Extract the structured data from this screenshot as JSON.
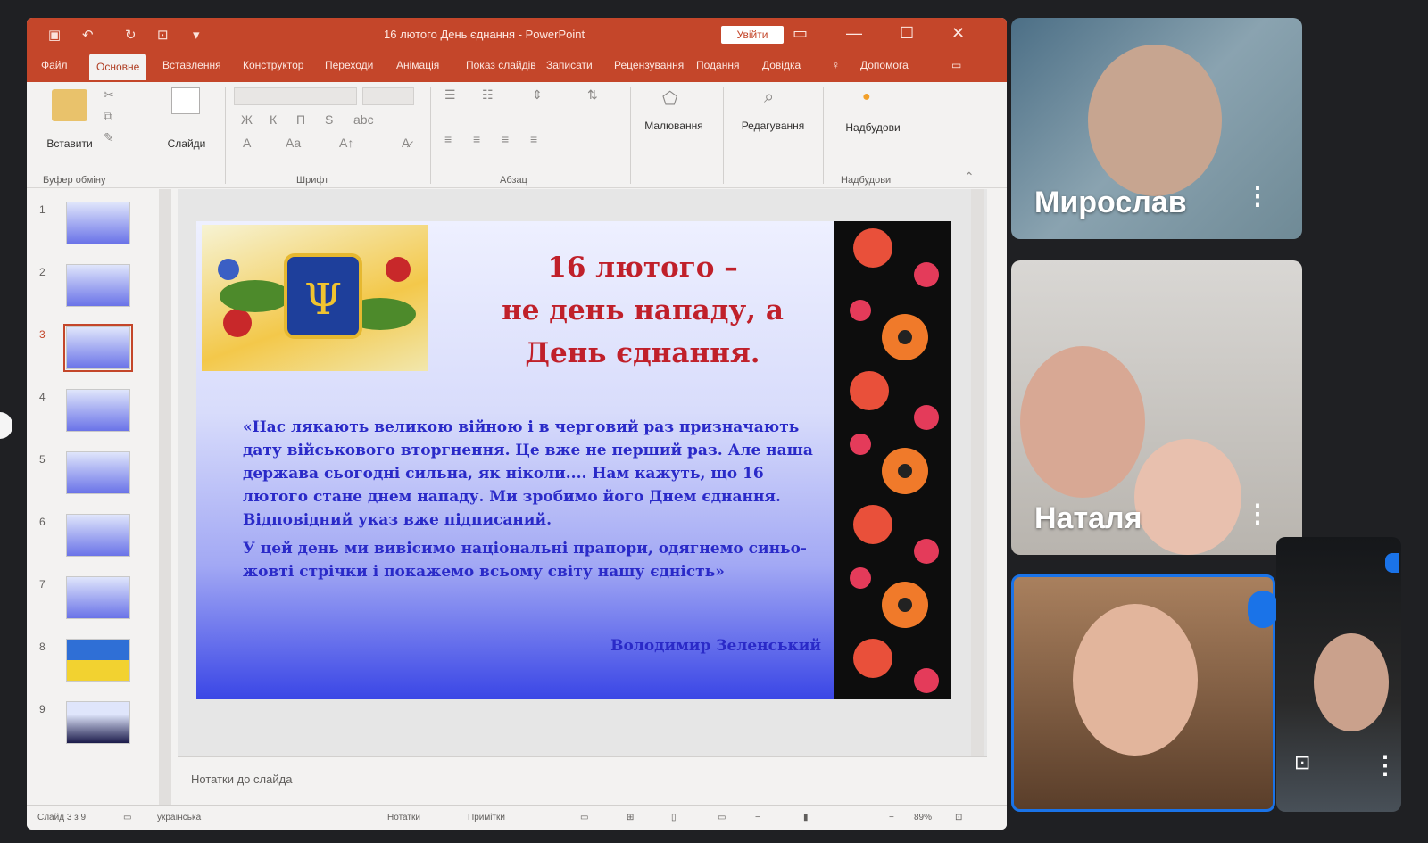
{
  "ppt": {
    "title": "16 лютого День єднання - PowerPoint",
    "signin": "Увійти",
    "tabs": [
      "Файл",
      "Основне",
      "Вставлення",
      "Конструктор",
      "Переходи",
      "Анімація",
      "Показ слайдів",
      "Записати",
      "Рецензування",
      "Подання",
      "Довідка",
      "Допомога"
    ],
    "ribbon": {
      "paste": "Вставити",
      "clipboard_group": "Буфер обміну",
      "slides": "Слайди",
      "font_group": "Шрифт",
      "paragraph_group": "Абзац",
      "drawing": "Малювання",
      "editing": "Редагування",
      "addins": "Надбудови",
      "addins_group": "Надбудови"
    },
    "thumbnails": [
      "1",
      "2",
      "3",
      "4",
      "5",
      "6",
      "7",
      "8",
      "9"
    ],
    "selected_slide": 3,
    "slide": {
      "heading": [
        "16 лютого –",
        "не день нападу, а",
        "День єднання."
      ],
      "quote": [
        "«Нас лякають великою війною і в черговий раз призначають дату військового вторгнення. Це вже не перший раз. Але наша держава сьогодні сильна, як ніколи.... Нам кажуть, що 16 лютого стане днем нападу. Ми зробимо його Днем єднання. Відповідний указ вже підписаний.",
        "У цей день ми вивісимо національні прапори, одягнемо синьо-жовті стрічки і покажемо всьому світу нашу єдність»"
      ],
      "author": "Володимир Зеленський"
    },
    "notes_placeholder": "Нотатки до слайда",
    "status": {
      "slide_of": "Слайд 3 з 9",
      "language": "українська",
      "notes": "Нотатки",
      "comments": "Примітки",
      "zoom": "89%"
    }
  },
  "participants": [
    {
      "name": "Мирослав"
    },
    {
      "name": "Наталя"
    },
    {
      "name": ""
    },
    {
      "name": ""
    }
  ],
  "colors": {
    "ppt_accent": "#c4462a",
    "active_speaker": "#1a73e8"
  }
}
